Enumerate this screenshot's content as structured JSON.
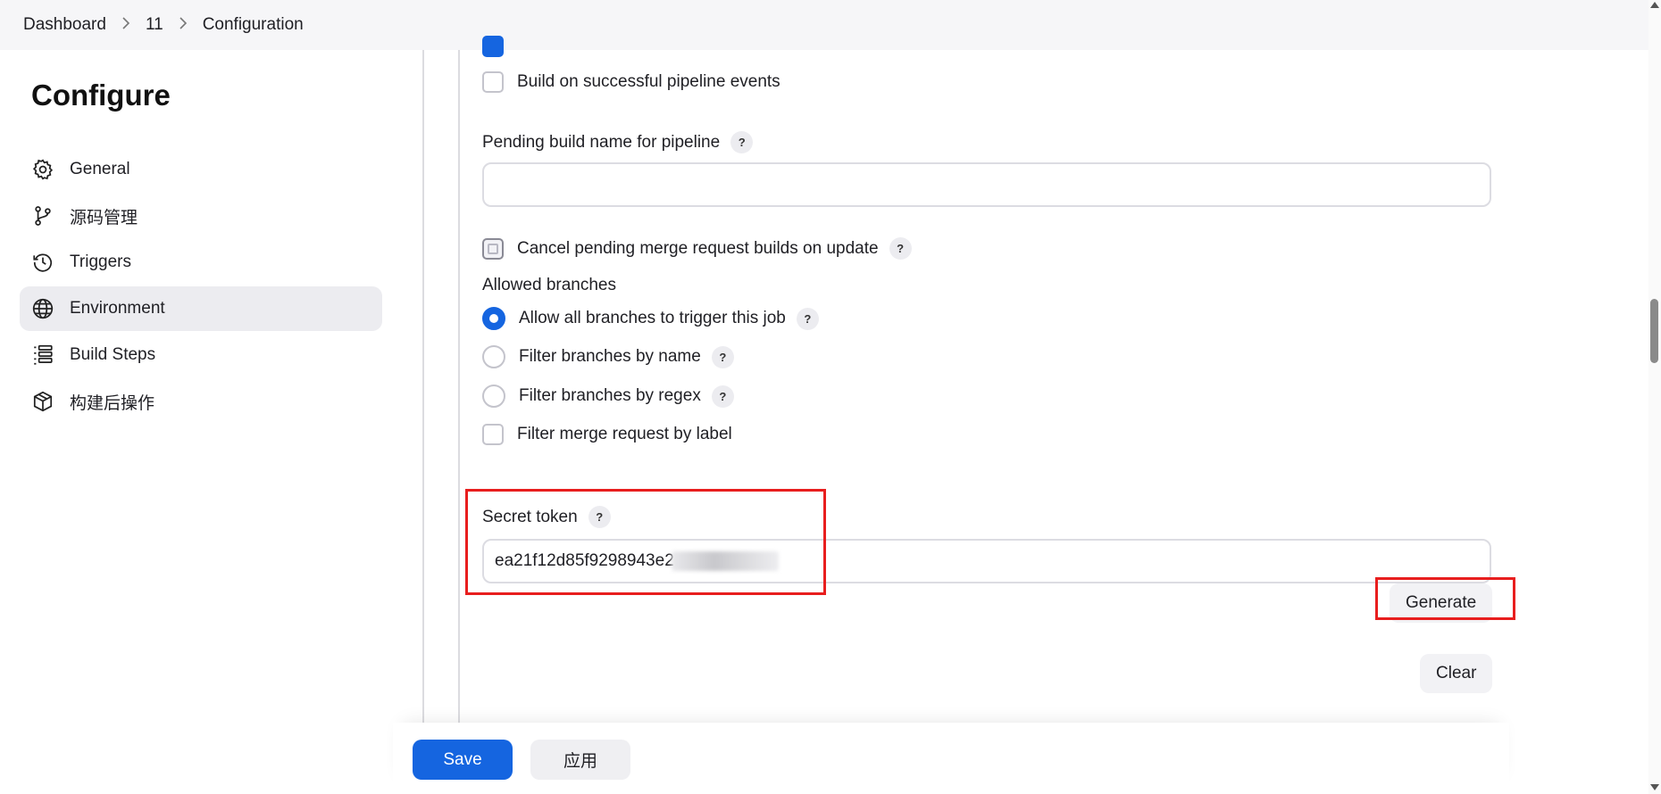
{
  "breadcrumb": [
    "Dashboard",
    "11",
    "Configuration"
  ],
  "page_title": "Configure",
  "sidebar": {
    "items": [
      {
        "label": "General",
        "icon": "gear-icon",
        "active": false
      },
      {
        "label": "源码管理",
        "icon": "branch-icon",
        "active": false
      },
      {
        "label": "Triggers",
        "icon": "clock-icon",
        "active": false
      },
      {
        "label": "Environment",
        "icon": "globe-icon",
        "active": true
      },
      {
        "label": "Build Steps",
        "icon": "list-icon",
        "active": false
      },
      {
        "label": "构建后操作",
        "icon": "package-icon",
        "active": false
      }
    ]
  },
  "form": {
    "successful_pipeline_label": "Build on successful pipeline events",
    "pending_build_label": "Pending build name for pipeline",
    "pending_build_value": "",
    "cancel_pending_label": "Cancel pending merge request builds on update",
    "allowed_branches_label": "Allowed branches",
    "branch_options": [
      "Allow all branches to trigger this job",
      "Filter branches by name",
      "Filter branches by regex"
    ],
    "filter_label_option": "Filter merge request by label",
    "secret_token_label": "Secret token",
    "secret_token_value": "ea21f12d85f9298943e2",
    "generate_label": "Generate",
    "clear_label": "Clear",
    "help_glyph": "?"
  },
  "footer": {
    "save_label": "Save",
    "apply_label": "应用"
  },
  "colors": {
    "accent": "#1565e0",
    "highlight_box": "#e81e1e"
  }
}
